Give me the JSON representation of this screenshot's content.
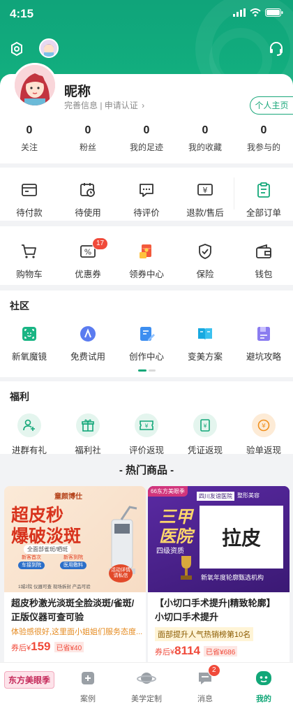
{
  "status_bar": {
    "time": "4:15"
  },
  "profile": {
    "nickname": "昵称",
    "sub_info": "完善信息 | 申请认证",
    "home_button": "个人主页"
  },
  "stats": [
    {
      "value": "0",
      "label": "关注"
    },
    {
      "value": "0",
      "label": "粉丝"
    },
    {
      "value": "0",
      "label": "我的足迹"
    },
    {
      "value": "0",
      "label": "我的收藏"
    },
    {
      "value": "0",
      "label": "我参与的"
    }
  ],
  "orders": [
    {
      "label": "待付款",
      "icon": "wallet-card-icon"
    },
    {
      "label": "待使用",
      "icon": "calendar-clock-icon"
    },
    {
      "label": "待评价",
      "icon": "comment-icon"
    },
    {
      "label": "退款/售后",
      "icon": "refund-icon"
    },
    {
      "label": "全部订单",
      "icon": "clipboard-icon"
    }
  ],
  "services": [
    {
      "label": "购物车",
      "icon": "cart-icon"
    },
    {
      "label": "优惠券",
      "icon": "coupon-icon",
      "badge": "17"
    },
    {
      "label": "领券中心",
      "icon": "red-packet-icon"
    },
    {
      "label": "保险",
      "icon": "shield-check-icon"
    },
    {
      "label": "钱包",
      "icon": "wallet-icon"
    }
  ],
  "community": {
    "title": "社区",
    "items": [
      {
        "label": "新氧魔镜",
        "icon": "face-scan-icon"
      },
      {
        "label": "免费试用",
        "icon": "trial-icon"
      },
      {
        "label": "创作中心",
        "icon": "edit-doc-icon"
      },
      {
        "label": "变美方案",
        "icon": "book-icon"
      },
      {
        "label": "避坑攻略",
        "icon": "guide-icon"
      }
    ]
  },
  "welfare": {
    "title": "福利",
    "items": [
      {
        "label": "进群有礼",
        "icon": "group-add-icon"
      },
      {
        "label": "福利社",
        "icon": "gift-icon"
      },
      {
        "label": "评价返现",
        "icon": "cashback-ticket-icon"
      },
      {
        "label": "凭证返现",
        "icon": "voucher-icon"
      },
      {
        "label": "验单返现",
        "icon": "coin-icon"
      }
    ]
  },
  "hot_title": "- 热门商品 -",
  "products": [
    {
      "image": {
        "brand": "童颜博仕",
        "headline1": "超皮秒",
        "headline2": "爆破淡斑",
        "subtitle": "全面部雀斑/晒斑",
        "tag1_title": "新客首次",
        "tag1_text": "车接到院",
        "tag2_title": "新客到院",
        "tag2_text": "医用敷料",
        "footer": "1城2院 仪器可查 现场拆封 产品可验",
        "sticker": "活动详情请私信"
      },
      "name": "超皮秒激光淡斑全脸淡斑/雀斑/正版仪器可查可验",
      "highlight": "体验感很好,这里面小姐姐们服务态度...",
      "price_tag": "券后¥",
      "price": "159",
      "save": "已省¥40"
    },
    {
      "image": {
        "corner": "66东方美眼季",
        "hospital": "四川友谊医院",
        "dept": "整形美容",
        "headline1": "三甲",
        "headline2": "医院",
        "level": "四级资质",
        "big_text": "拉皮",
        "footer": "新氧年度轮廓甄选机构"
      },
      "name": "【小切口手术提升|精致轮廓】小切口手术提升",
      "tip": "面部提升人气热销榜第10名",
      "price_tag": "券后¥",
      "price": "8114",
      "save": "已省¥686"
    }
  ],
  "tabbar": [
    {
      "label": "东方美眼季",
      "icon": "festival-logo-icon"
    },
    {
      "label": "案例",
      "icon": "case-icon"
    },
    {
      "label": "美学定制",
      "icon": "planet-icon"
    },
    {
      "label": "消息",
      "icon": "message-icon",
      "badge": "2"
    },
    {
      "label": "我的",
      "icon": "me-icon",
      "active": true
    }
  ],
  "colors": {
    "brand": "#12a778",
    "price": "#f04a3a",
    "accent": "#e58a1f"
  }
}
